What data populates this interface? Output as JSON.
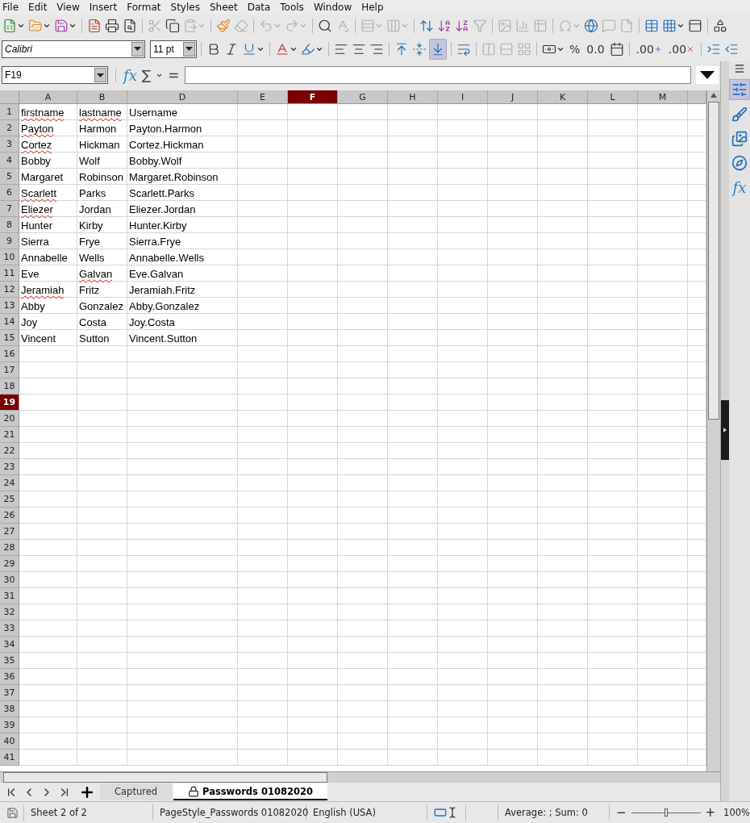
{
  "menu": [
    "File",
    "Edit",
    "View",
    "Insert",
    "Format",
    "Styles",
    "Sheet",
    "Data",
    "Tools",
    "Window",
    "Help"
  ],
  "standard_toolbar": [
    {
      "kind": "new",
      "dropdown": true,
      "disabled": false
    },
    {
      "kind": "open",
      "dropdown": true,
      "disabled": false
    },
    {
      "kind": "save",
      "dropdown": true,
      "disabled": false
    },
    {
      "kind": "sep"
    },
    {
      "kind": "pdf",
      "dropdown": false,
      "disabled": false
    },
    {
      "kind": "print",
      "dropdown": false,
      "disabled": false
    },
    {
      "kind": "preview",
      "dropdown": false,
      "disabled": false
    },
    {
      "kind": "sep"
    },
    {
      "kind": "cut",
      "dropdown": false,
      "disabled": true
    },
    {
      "kind": "copy",
      "dropdown": false,
      "disabled": false
    },
    {
      "kind": "paste",
      "dropdown": true,
      "disabled": true
    },
    {
      "kind": "sep"
    },
    {
      "kind": "clone",
      "dropdown": false,
      "disabled": false
    },
    {
      "kind": "clear",
      "dropdown": false,
      "disabled": true
    },
    {
      "kind": "sep"
    },
    {
      "kind": "undo",
      "dropdown": true,
      "disabled": true
    },
    {
      "kind": "redo",
      "dropdown": true,
      "disabled": true
    },
    {
      "kind": "sep"
    },
    {
      "kind": "find",
      "dropdown": false,
      "disabled": false
    },
    {
      "kind": "spelling",
      "dropdown": false,
      "disabled": true
    },
    {
      "kind": "sep"
    },
    {
      "kind": "rows",
      "dropdown": true,
      "disabled": true
    },
    {
      "kind": "columns",
      "dropdown": true,
      "disabled": true
    },
    {
      "kind": "sep"
    },
    {
      "kind": "sort",
      "dropdown": false,
      "disabled": false
    },
    {
      "kind": "sort-asc",
      "dropdown": false,
      "disabled": false
    },
    {
      "kind": "sort-desc",
      "dropdown": false,
      "disabled": false
    },
    {
      "kind": "autofilter",
      "dropdown": false,
      "disabled": true
    },
    {
      "kind": "sep"
    },
    {
      "kind": "image",
      "dropdown": false,
      "disabled": true
    },
    {
      "kind": "chart",
      "dropdown": false,
      "disabled": true
    },
    {
      "kind": "pivot",
      "dropdown": false,
      "disabled": true
    },
    {
      "kind": "sep"
    },
    {
      "kind": "special-char",
      "dropdown": true,
      "disabled": true
    },
    {
      "kind": "hyperlink",
      "dropdown": false,
      "disabled": false
    },
    {
      "kind": "comment",
      "dropdown": false,
      "disabled": true
    },
    {
      "kind": "header",
      "dropdown": false,
      "disabled": true
    },
    {
      "kind": "sep"
    },
    {
      "kind": "define-range",
      "dropdown": false,
      "disabled": false
    },
    {
      "kind": "freeze",
      "dropdown": true,
      "disabled": false
    },
    {
      "kind": "split",
      "dropdown": false,
      "disabled": false
    },
    {
      "kind": "sep"
    },
    {
      "kind": "shapes",
      "dropdown": false,
      "disabled": false
    }
  ],
  "formatting_toolbar": {
    "font_name": "Calibri",
    "font_size": "11 pt",
    "items": [
      {
        "kind": "sep"
      },
      {
        "kind": "bold",
        "dropdown": false,
        "disabled": false,
        "active": false
      },
      {
        "kind": "italic",
        "dropdown": false,
        "disabled": false,
        "active": false
      },
      {
        "kind": "underline",
        "dropdown": true,
        "disabled": false,
        "active": false
      },
      {
        "kind": "sep"
      },
      {
        "kind": "font-color",
        "dropdown": true,
        "disabled": false,
        "active": false
      },
      {
        "kind": "highlight",
        "dropdown": true,
        "disabled": false,
        "active": false
      },
      {
        "kind": "sep"
      },
      {
        "kind": "align-left",
        "dropdown": false,
        "disabled": false,
        "active": false
      },
      {
        "kind": "align-center",
        "dropdown": false,
        "disabled": false,
        "active": false
      },
      {
        "kind": "align-right",
        "dropdown": false,
        "disabled": false,
        "active": false
      },
      {
        "kind": "sep"
      },
      {
        "kind": "align-top",
        "dropdown": false,
        "disabled": false,
        "active": false
      },
      {
        "kind": "align-middle",
        "dropdown": false,
        "disabled": false,
        "active": false
      },
      {
        "kind": "align-bottom",
        "dropdown": false,
        "disabled": false,
        "active": true
      },
      {
        "kind": "sep"
      },
      {
        "kind": "wrap",
        "dropdown": false,
        "disabled": false,
        "active": false
      },
      {
        "kind": "sep"
      },
      {
        "kind": "merge-center",
        "dropdown": false,
        "disabled": true,
        "active": false
      },
      {
        "kind": "merge",
        "dropdown": false,
        "disabled": true,
        "active": false
      },
      {
        "kind": "unmerge",
        "dropdown": false,
        "disabled": true,
        "active": false
      },
      {
        "kind": "sep"
      },
      {
        "kind": "currency",
        "dropdown": true,
        "disabled": false,
        "active": false
      },
      {
        "kind": "text",
        "label": "%",
        "dropdown": false,
        "disabled": false,
        "active": false
      },
      {
        "kind": "text",
        "label": "0.0",
        "dropdown": false,
        "disabled": false,
        "active": false
      },
      {
        "kind": "date",
        "dropdown": false,
        "disabled": false,
        "active": false
      },
      {
        "kind": "sep"
      },
      {
        "kind": "add-decimal",
        "label": ".00",
        "dropdown": false,
        "disabled": false,
        "active": false
      },
      {
        "kind": "delete-decimal",
        "label": ".00",
        "dropdown": false,
        "disabled": false,
        "active": false
      },
      {
        "kind": "sep"
      },
      {
        "kind": "indent",
        "dropdown": false,
        "disabled": false,
        "active": false
      },
      {
        "kind": "outdent",
        "dropdown": false,
        "disabled": false,
        "active": false
      }
    ]
  },
  "formula_bar": {
    "cell_ref": "F19",
    "function_wizard": "fx",
    "sum": "∑",
    "equals": "="
  },
  "columns": [
    {
      "label": "A",
      "selected": false
    },
    {
      "label": "B",
      "selected": false
    },
    {
      "label": "D",
      "selected": false
    },
    {
      "label": "E",
      "selected": false
    },
    {
      "label": "F",
      "selected": true
    },
    {
      "label": "G",
      "selected": false
    },
    {
      "label": "H",
      "selected": false
    },
    {
      "label": "I",
      "selected": false
    },
    {
      "label": "J",
      "selected": false
    },
    {
      "label": "K",
      "selected": false
    },
    {
      "label": "L",
      "selected": false
    },
    {
      "label": "M",
      "selected": false
    }
  ],
  "row_headers": [
    {
      "label": "1",
      "selected": false
    },
    {
      "label": "2",
      "selected": false
    },
    {
      "label": "3",
      "selected": false
    },
    {
      "label": "4",
      "selected": false
    },
    {
      "label": "5",
      "selected": false
    },
    {
      "label": "6",
      "selected": false
    },
    {
      "label": "7",
      "selected": false
    },
    {
      "label": "8",
      "selected": false
    },
    {
      "label": "9",
      "selected": false
    },
    {
      "label": "10",
      "selected": false
    },
    {
      "label": "11",
      "selected": false
    },
    {
      "label": "12",
      "selected": false
    },
    {
      "label": "13",
      "selected": false
    },
    {
      "label": "14",
      "selected": false
    },
    {
      "label": "15",
      "selected": false
    },
    {
      "label": "16",
      "selected": false
    },
    {
      "label": "17",
      "selected": false
    },
    {
      "label": "18",
      "selected": false
    },
    {
      "label": "19",
      "selected": true
    },
    {
      "label": "20",
      "selected": false
    },
    {
      "label": "21",
      "selected": false
    },
    {
      "label": "22",
      "selected": false
    },
    {
      "label": "23",
      "selected": false
    },
    {
      "label": "24",
      "selected": false
    },
    {
      "label": "25",
      "selected": false
    },
    {
      "label": "26",
      "selected": false
    },
    {
      "label": "27",
      "selected": false
    },
    {
      "label": "28",
      "selected": false
    },
    {
      "label": "29",
      "selected": false
    },
    {
      "label": "30",
      "selected": false
    },
    {
      "label": "31",
      "selected": false
    },
    {
      "label": "32",
      "selected": false
    },
    {
      "label": "33",
      "selected": false
    },
    {
      "label": "34",
      "selected": false
    },
    {
      "label": "35",
      "selected": false
    },
    {
      "label": "36",
      "selected": false
    },
    {
      "label": "37",
      "selected": false
    },
    {
      "label": "38",
      "selected": false
    },
    {
      "label": "39",
      "selected": false
    },
    {
      "label": "40",
      "selected": false
    },
    {
      "label": "41",
      "selected": false
    }
  ],
  "rows": [
    [
      {
        "text": "firstname",
        "misspelled": true
      },
      {
        "text": "lastname",
        "misspelled": true
      },
      {
        "text": "Username",
        "misspelled": false
      }
    ],
    [
      {
        "text": "Payton",
        "misspelled": true
      },
      {
        "text": "Harmon",
        "misspelled": false
      },
      {
        "text": "Payton.Harmon",
        "misspelled": false
      }
    ],
    [
      {
        "text": "Cortez",
        "misspelled": true
      },
      {
        "text": "Hickman",
        "misspelled": false
      },
      {
        "text": "Cortez.Hickman",
        "misspelled": false
      }
    ],
    [
      {
        "text": "Bobby",
        "misspelled": false
      },
      {
        "text": "Wolf",
        "misspelled": false
      },
      {
        "text": "Bobby.Wolf",
        "misspelled": false
      }
    ],
    [
      {
        "text": "Margaret",
        "misspelled": false
      },
      {
        "text": "Robinson",
        "misspelled": false
      },
      {
        "text": "Margaret.Robinson",
        "misspelled": false
      }
    ],
    [
      {
        "text": "Scarlett",
        "misspelled": true
      },
      {
        "text": "Parks",
        "misspelled": false
      },
      {
        "text": "Scarlett.Parks",
        "misspelled": false
      }
    ],
    [
      {
        "text": "Eliezer",
        "misspelled": true
      },
      {
        "text": "Jordan",
        "misspelled": false
      },
      {
        "text": "Eliezer.Jordan",
        "misspelled": false
      }
    ],
    [
      {
        "text": "Hunter",
        "misspelled": false
      },
      {
        "text": "Kirby",
        "misspelled": false
      },
      {
        "text": "Hunter.Kirby",
        "misspelled": false
      }
    ],
    [
      {
        "text": "Sierra",
        "misspelled": false
      },
      {
        "text": "Frye",
        "misspelled": false
      },
      {
        "text": "Sierra.Frye",
        "misspelled": false
      }
    ],
    [
      {
        "text": "Annabelle",
        "misspelled": false
      },
      {
        "text": "Wells",
        "misspelled": false
      },
      {
        "text": "Annabelle.Wells",
        "misspelled": false
      }
    ],
    [
      {
        "text": "Eve",
        "misspelled": false
      },
      {
        "text": "Galvan",
        "misspelled": true
      },
      {
        "text": "Eve.Galvan",
        "misspelled": false
      }
    ],
    [
      {
        "text": "Jeramiah",
        "misspelled": true
      },
      {
        "text": "Fritz",
        "misspelled": false
      },
      {
        "text": "Jeramiah.Fritz",
        "misspelled": false
      }
    ],
    [
      {
        "text": "Abby",
        "misspelled": false
      },
      {
        "text": "Gonzalez",
        "misspelled": false
      },
      {
        "text": "Abby.Gonzalez",
        "misspelled": false
      }
    ],
    [
      {
        "text": "Joy",
        "misspelled": false
      },
      {
        "text": "Costa",
        "misspelled": false
      },
      {
        "text": "Joy.Costa",
        "misspelled": false
      }
    ],
    [
      {
        "text": "Vincent",
        "misspelled": false
      },
      {
        "text": "Sutton",
        "misspelled": false
      },
      {
        "text": "Vincent.Sutton",
        "misspelled": false
      }
    ]
  ],
  "sheet_tabs": [
    {
      "label": "Captured",
      "selected": false,
      "locked": false
    },
    {
      "label": "Passwords 01082020",
      "selected": true,
      "locked": true
    }
  ],
  "sidebar": [
    {
      "kind": "properties",
      "selected": true
    },
    {
      "kind": "styles",
      "selected": false
    },
    {
      "kind": "gallery",
      "selected": false
    },
    {
      "kind": "navigator",
      "selected": false
    },
    {
      "kind": "functions",
      "label": "fx",
      "selected": false
    }
  ],
  "status_bar": {
    "sheet": "Sheet 2 of 2",
    "page_style": "PageStyle_Passwords 01082020",
    "language": "English (USA)",
    "summary": "Average: ; Sum: 0",
    "zoom_minus": "−",
    "zoom_plus": "+",
    "zoom": {
      "level": 0.5
    },
    "zoom_percent": "100%"
  }
}
